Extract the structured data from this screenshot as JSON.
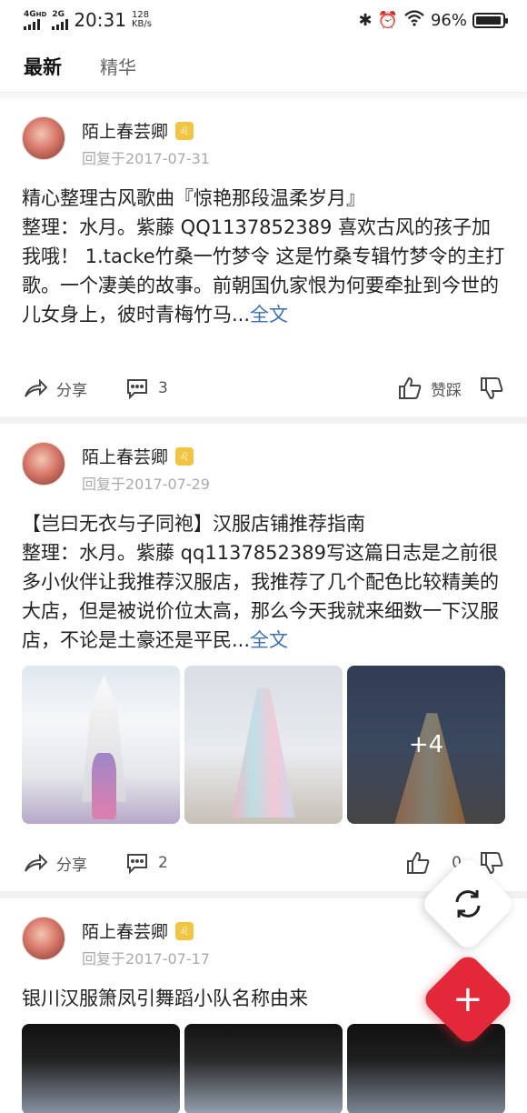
{
  "status_bar": {
    "net1": "4G",
    "net1_sup": "HD",
    "net2": "2G",
    "time": "20:31",
    "speed_value": "128",
    "speed_unit": "KB/s",
    "battery": "96%"
  },
  "tabs": [
    {
      "label": "最新",
      "active": true
    },
    {
      "label": "精华",
      "active": false
    }
  ],
  "posts": [
    {
      "author": "陌上春芸卿",
      "date": "回复于2017-07-31",
      "title": "精心整理古风歌曲『惊艳那段温柔岁月』",
      "body": "整理：水月。紫藤 QQ1137852389 喜欢古风的孩子加我哦！ 1.tacke竹桑一竹梦令 这是竹桑专辑竹梦令的主打歌。一个凄美的故事。前朝国仇家恨为何要牵扯到今世的儿女身上，彼时青梅竹马...",
      "more": "全文",
      "share": "分享",
      "comments": "3",
      "like_label": "赞踩"
    },
    {
      "author": "陌上春芸卿",
      "date": "回复于2017-07-29",
      "title": "【岂曰无衣与子同袍】汉服店铺推荐指南",
      "body": "整理：水月。紫藤 qq1137852389写这篇日志是之前很多小伙伴让我推荐汉服店，我推荐了几个配色比较精美的大店，但是被说价位太高，那么今天我就来细数一下汉服店，不论是土豪还是平民...",
      "more": "全文",
      "share": "分享",
      "comments": "2",
      "like_label": "0",
      "more_images": "+4"
    },
    {
      "author": "陌上春芸卿",
      "date": "回复于2017-07-17",
      "title": "银川汉服箫凤引舞蹈小队名称由来"
    }
  ],
  "fab": {
    "add": "+"
  },
  "colors": {
    "accent": "#e3283a",
    "link": "#3a6fb0",
    "badge": "#f3c442"
  }
}
